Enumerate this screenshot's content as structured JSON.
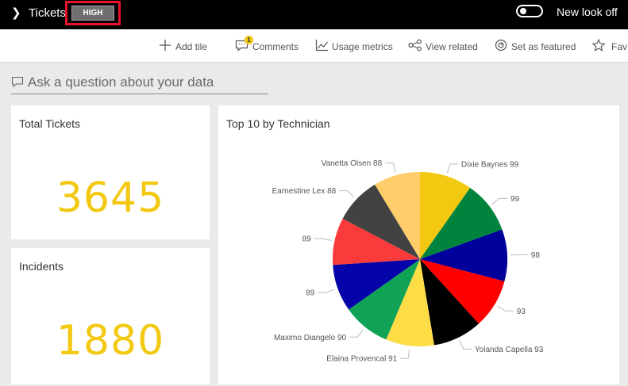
{
  "header": {
    "breadcrumb_title": "Tickets",
    "badge_label": "HIGH",
    "toggle_label": "New look off"
  },
  "toolbar": {
    "add_tile": "Add tile",
    "comments": "Comments",
    "comments_count": "1",
    "usage_metrics": "Usage metrics",
    "view_related": "View related",
    "set_as_featured": "Set as featured",
    "favorite": "Fav"
  },
  "qa": {
    "placeholder": "Ask a question about your data"
  },
  "tiles": {
    "total_tickets": {
      "title": "Total Tickets",
      "value": "3645"
    },
    "incidents": {
      "title": "Incidents",
      "value": "1880"
    },
    "top10": {
      "title": "Top 10 by Technician"
    }
  },
  "chart_data": {
    "type": "pie",
    "title": "Top 10 by Technician",
    "slices": [
      {
        "label": "Dixie Baynes 99",
        "value": 99,
        "color": "#f2c811"
      },
      {
        "label": "99",
        "value": 99,
        "color": "#00843d"
      },
      {
        "label": "98",
        "value": 98,
        "color": "#00009b"
      },
      {
        "label": "93",
        "value": 93,
        "color": "#ff0000"
      },
      {
        "label": "Yolanda Capella 93",
        "value": 93,
        "color": "#000000"
      },
      {
        "label": "Elaina Provencal 91",
        "value": 91,
        "color": "#fddd46"
      },
      {
        "label": "Maximo Diangelo 90",
        "value": 90,
        "color": "#10a356"
      },
      {
        "label": "89",
        "value": 89,
        "color": "#0404a8"
      },
      {
        "label": "89",
        "value": 89,
        "color": "#fa3b3b"
      },
      {
        "label": "Earnestine Lex 88",
        "value": 88,
        "color": "#424242"
      },
      {
        "label": "Vanetta Olsen 88",
        "value": 88,
        "color": "#ffce6b"
      }
    ]
  }
}
